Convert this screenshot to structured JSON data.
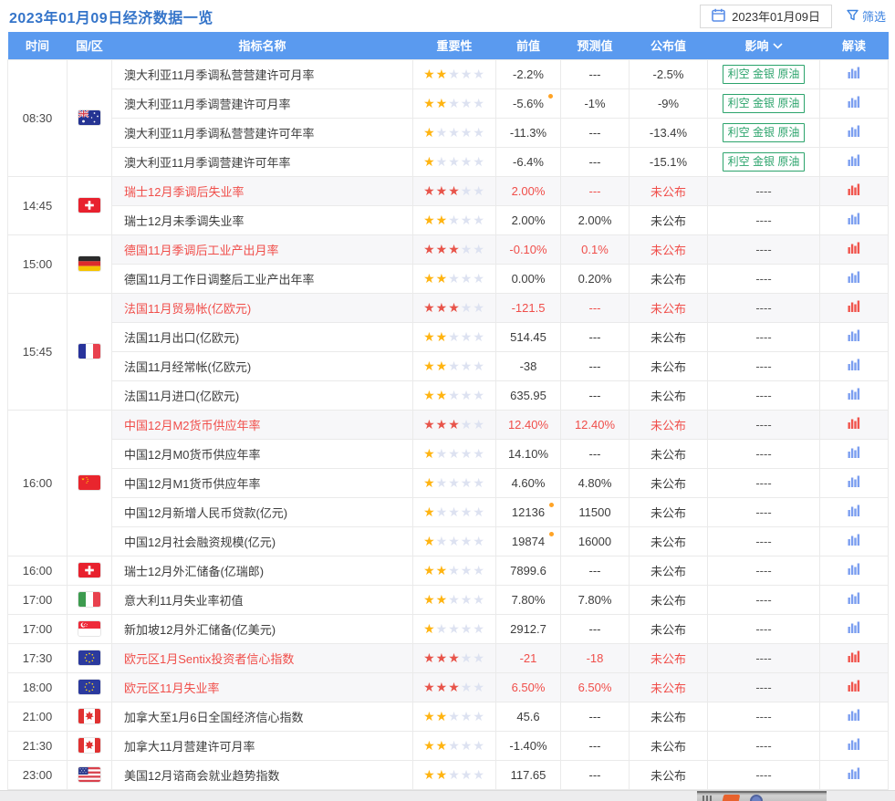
{
  "header": {
    "title": "2023年01月09日经济数据一览",
    "date_value": "2023年01月09日",
    "filter_label": "筛选"
  },
  "colors": {
    "header_bg": "#5a9aef",
    "title_blue": "#3474c9",
    "link_blue": "#3b82e0",
    "highlight_red": "#f04e4a",
    "star_gold": "#ffb411",
    "star_empty": "#dde2f1",
    "tag_green": "#2ba36b",
    "chart_icon_blue": "#7b9ef0",
    "revision_dot_orange": "#ffa325",
    "highlight_row_bg": "#f7f7f9"
  },
  "table": {
    "columns": [
      "时间",
      "国/区",
      "指标名称",
      "重要性",
      "前值",
      "预测值",
      "公布值",
      "影响",
      "解读"
    ],
    "impact_dropdown_column_index": 7,
    "groups": [
      {
        "time": "08:30",
        "flag": "au",
        "rows": [
          {
            "name": "澳大利亚11月季调私营营建许可月率",
            "stars": 2,
            "highlight": false,
            "prev": "-2.2%",
            "prev_dot": false,
            "forecast": "---",
            "published": "-2.5%",
            "impact": "利空 金银 原油",
            "impact_type": "tag"
          },
          {
            "name": "澳大利亚11月季调营建许可月率",
            "stars": 2,
            "highlight": false,
            "prev": "-5.6%",
            "prev_dot": true,
            "forecast": "-1%",
            "published": "-9%",
            "impact": "利空 金银 原油",
            "impact_type": "tag"
          },
          {
            "name": "澳大利亚11月季调私营营建许可年率",
            "stars": 1,
            "highlight": false,
            "prev": "-11.3%",
            "prev_dot": false,
            "forecast": "---",
            "published": "-13.4%",
            "impact": "利空 金银 原油",
            "impact_type": "tag"
          },
          {
            "name": "澳大利亚11月季调营建许可年率",
            "stars": 1,
            "highlight": false,
            "prev": "-6.4%",
            "prev_dot": false,
            "forecast": "---",
            "published": "-15.1%",
            "impact": "利空 金银 原油",
            "impact_type": "tag"
          }
        ]
      },
      {
        "time": "14:45",
        "flag": "ch",
        "rows": [
          {
            "name": "瑞士12月季调后失业率",
            "stars": 3,
            "highlight": true,
            "prev": "2.00%",
            "prev_dot": false,
            "forecast": "---",
            "published": "未公布",
            "impact": "----",
            "impact_type": "dashes"
          },
          {
            "name": "瑞士12月未季调失业率",
            "stars": 2,
            "highlight": false,
            "prev": "2.00%",
            "prev_dot": false,
            "forecast": "2.00%",
            "published": "未公布",
            "impact": "----",
            "impact_type": "dashes"
          }
        ]
      },
      {
        "time": "15:00",
        "flag": "de",
        "rows": [
          {
            "name": "德国11月季调后工业产出月率",
            "stars": 3,
            "highlight": true,
            "prev": "-0.10%",
            "prev_dot": false,
            "forecast": "0.1%",
            "published": "未公布",
            "impact": "----",
            "impact_type": "dashes"
          },
          {
            "name": "德国11月工作日调整后工业产出年率",
            "stars": 2,
            "highlight": false,
            "prev": "0.00%",
            "prev_dot": false,
            "forecast": "0.20%",
            "published": "未公布",
            "impact": "----",
            "impact_type": "dashes"
          }
        ]
      },
      {
        "time": "15:45",
        "flag": "fr",
        "rows": [
          {
            "name": "法国11月贸易帐(亿欧元)",
            "stars": 3,
            "highlight": true,
            "prev": "-121.5",
            "prev_dot": false,
            "forecast": "---",
            "published": "未公布",
            "impact": "----",
            "impact_type": "dashes"
          },
          {
            "name": "法国11月出口(亿欧元)",
            "stars": 2,
            "highlight": false,
            "prev": "514.45",
            "prev_dot": false,
            "forecast": "---",
            "published": "未公布",
            "impact": "----",
            "impact_type": "dashes"
          },
          {
            "name": "法国11月经常帐(亿欧元)",
            "stars": 2,
            "highlight": false,
            "prev": "-38",
            "prev_dot": false,
            "forecast": "---",
            "published": "未公布",
            "impact": "----",
            "impact_type": "dashes"
          },
          {
            "name": "法国11月进口(亿欧元)",
            "stars": 2,
            "highlight": false,
            "prev": "635.95",
            "prev_dot": false,
            "forecast": "---",
            "published": "未公布",
            "impact": "----",
            "impact_type": "dashes"
          }
        ]
      },
      {
        "time": "16:00",
        "flag": "cn",
        "rows": [
          {
            "name": "中国12月M2货币供应年率",
            "stars": 3,
            "highlight": true,
            "prev": "12.40%",
            "prev_dot": false,
            "forecast": "12.40%",
            "published": "未公布",
            "impact": "----",
            "impact_type": "dashes"
          },
          {
            "name": "中国12月M0货币供应年率",
            "stars": 1,
            "highlight": false,
            "prev": "14.10%",
            "prev_dot": false,
            "forecast": "---",
            "published": "未公布",
            "impact": "----",
            "impact_type": "dashes"
          },
          {
            "name": "中国12月M1货币供应年率",
            "stars": 1,
            "highlight": false,
            "prev": "4.60%",
            "prev_dot": false,
            "forecast": "4.80%",
            "published": "未公布",
            "impact": "----",
            "impact_type": "dashes"
          },
          {
            "name": "中国12月新增人民币贷款(亿元)",
            "stars": 1,
            "highlight": false,
            "prev": "12136",
            "prev_dot": true,
            "forecast": "11500",
            "published": "未公布",
            "impact": "----",
            "impact_type": "dashes"
          },
          {
            "name": "中国12月社会融资规模(亿元)",
            "stars": 1,
            "highlight": false,
            "prev": "19874",
            "prev_dot": true,
            "forecast": "16000",
            "published": "未公布",
            "impact": "----",
            "impact_type": "dashes"
          }
        ]
      },
      {
        "time": "16:00",
        "flag": "ch",
        "rows": [
          {
            "name": "瑞士12月外汇储备(亿瑞郎)",
            "stars": 2,
            "highlight": false,
            "prev": "7899.6",
            "prev_dot": false,
            "forecast": "---",
            "published": "未公布",
            "impact": "----",
            "impact_type": "dashes"
          }
        ]
      },
      {
        "time": "17:00",
        "flag": "it",
        "rows": [
          {
            "name": "意大利11月失业率初值",
            "stars": 2,
            "highlight": false,
            "prev": "7.80%",
            "prev_dot": false,
            "forecast": "7.80%",
            "published": "未公布",
            "impact": "----",
            "impact_type": "dashes"
          }
        ]
      },
      {
        "time": "17:00",
        "flag": "sg",
        "rows": [
          {
            "name": "新加坡12月外汇储备(亿美元)",
            "stars": 1,
            "highlight": false,
            "prev": "2912.7",
            "prev_dot": false,
            "forecast": "---",
            "published": "未公布",
            "impact": "----",
            "impact_type": "dashes"
          }
        ]
      },
      {
        "time": "17:30",
        "flag": "eu",
        "rows": [
          {
            "name": "欧元区1月Sentix投资者信心指数",
            "stars": 3,
            "highlight": true,
            "prev": "-21",
            "prev_dot": false,
            "forecast": "-18",
            "published": "未公布",
            "impact": "----",
            "impact_type": "dashes"
          }
        ]
      },
      {
        "time": "18:00",
        "flag": "eu",
        "rows": [
          {
            "name": "欧元区11月失业率",
            "stars": 3,
            "highlight": true,
            "prev": "6.50%",
            "prev_dot": false,
            "forecast": "6.50%",
            "published": "未公布",
            "impact": "----",
            "impact_type": "dashes"
          }
        ]
      },
      {
        "time": "21:00",
        "flag": "ca",
        "rows": [
          {
            "name": "加拿大至1月6日全国经济信心指数",
            "stars": 2,
            "highlight": false,
            "prev": "45.6",
            "prev_dot": false,
            "forecast": "---",
            "published": "未公布",
            "impact": "----",
            "impact_type": "dashes"
          }
        ]
      },
      {
        "time": "21:30",
        "flag": "ca",
        "rows": [
          {
            "name": "加拿大11月营建许可月率",
            "stars": 2,
            "highlight": false,
            "prev": "-1.40%",
            "prev_dot": false,
            "forecast": "---",
            "published": "未公布",
            "impact": "----",
            "impact_type": "dashes"
          }
        ]
      },
      {
        "time": "23:00",
        "flag": "us",
        "rows": [
          {
            "name": "美国12月谘商会就业趋势指数",
            "stars": 2,
            "highlight": false,
            "prev": "117.65",
            "prev_dot": false,
            "forecast": "---",
            "published": "未公布",
            "impact": "----",
            "impact_type": "dashes"
          }
        ]
      }
    ]
  }
}
